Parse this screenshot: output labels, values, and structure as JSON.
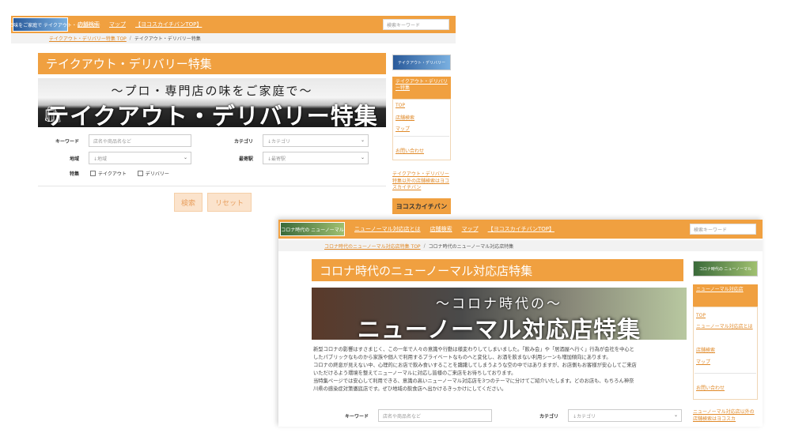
{
  "shot1": {
    "logo_text": "プロ・専門店の味をご家庭で テイクアウト・デリバリー",
    "nav": [
      "店舗検索",
      "マップ",
      "【ヨコスカイチバンTOP】"
    ],
    "search_placeholder": "検索キーワード",
    "breadcrumb": {
      "link": "テイクアウト・デリバリー特集 TOP",
      "sep": "/",
      "current": "テイクアウト・デリバリー特集"
    },
    "title": "テイクアウト・デリバリー特集",
    "banner": {
      "sub": "〜プロ・専門店の味をご家庭で〜",
      "main": "テイクアウト・デリバリー特集"
    },
    "form": {
      "keyword_label": "キーワード",
      "keyword_placeholder": "店名や商品名など",
      "category_label": "カテゴリ",
      "category_value": "↓カテゴリ",
      "area_label": "地域",
      "area_value": "↓地域",
      "station_label": "最寄駅",
      "station_value": "↓最寄駅",
      "feature_label": "特集",
      "feature_options": [
        "テイクアウト",
        "デリバリー"
      ],
      "search_button": "検索",
      "reset_button": "リセット"
    },
    "sidebar": {
      "logo_text": "テイクアウト・デリバリー",
      "heading": "テイクアウト・デリバリー特集",
      "links": [
        "TOP",
        "店舗検索",
        "マップ"
      ],
      "contact": "お問い合わせ",
      "note": "テイクアウト・デリバリー特集以外の店舗検索はヨコスカイチバン",
      "brand": "ヨコスカイチバン"
    }
  },
  "shot2": {
    "logo_text": "コロナ時代の ニューノーマル",
    "nav": [
      "ニューノーマル対応店とは",
      "店舗検索",
      "マップ",
      "【ヨコスカイチバンTOP】"
    ],
    "search_placeholder": "検索キーワード",
    "breadcrumb": {
      "link": "コロナ時代のニューノーマル対応店特集 TOP",
      "sep": "/",
      "current": "コロナ時代のニューノーマル対応店特集"
    },
    "title": "コロナ時代のニューノーマル対応店特集",
    "banner": {
      "sub": "〜コロナ時代の〜",
      "main": "ニューノーマル対応店特集"
    },
    "description": [
      "新型コロナの影響はすさまじく、この一年で人々の意識や行動は様変わりしてしまいました。「飲み会」や「居酒屋へ行く」行為が会社を中心と",
      "したパブリックなものから家族や個人で利用するプライベートなものへと変化し、お酒を飲まない利用シーンも増加傾向にあります。",
      "コロナの終息が見えない中、心理的にお店で飲み食いすることを躊躇してしまうような空の中ではありますが、お店側もお客様が安心してご来店",
      "いただけるよう環境を整えてニューノーマルに対応し皆様のご来店をお待ちしております。",
      "当特集ページでは安心して利用できる、意識の高いニューノーマル対応店を3つのテーマに分けてご紹介いたします。どのお店も、もちろん神奈",
      "川県の感染症対策徹底店です。ぜひ地域の飲食店へ出かけるきっかけにしてください。"
    ],
    "form": {
      "keyword_label": "キーワード",
      "keyword_placeholder": "店名や商品名など",
      "category_label": "カテゴリ",
      "category_value": "↓カテゴリ"
    },
    "sidebar": {
      "logo_text": "コロナ時代の ニューノーマル",
      "heading": "ニューノーマル対応店",
      "links": [
        "TOP",
        "ニューノーマル対応店とは",
        "店舗検索",
        "マップ"
      ],
      "contact": "お問い合わせ",
      "note": "ニューノーマル対応店以外の店舗検索はヨコスカ"
    }
  }
}
